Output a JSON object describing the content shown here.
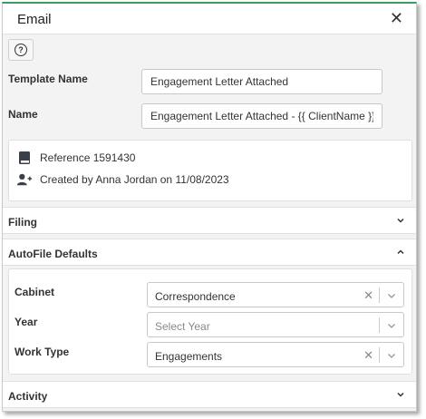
{
  "dialog": {
    "title": "Email",
    "close_glyph": "✕"
  },
  "help": {
    "glyph": "?",
    "icon": "question-circle-icon"
  },
  "form": {
    "template_name_label": "Template Name",
    "template_name_value": "Engagement Letter Attached",
    "name_label": "Name",
    "name_value": "Engagement Letter Attached - {{ ClientName }}"
  },
  "info": {
    "reference": "Reference 1591430",
    "reference_icon": "book-icon",
    "created": "Created by Anna Jordan on 11/08/2023",
    "created_icon": "user-plus-icon"
  },
  "sections": {
    "filing": "Filing",
    "autofile": "AutoFile Defaults",
    "activity": "Activity"
  },
  "autofile": {
    "cabinet_label": "Cabinet",
    "cabinet_value": "Correspondence",
    "year_label": "Year",
    "year_placeholder": "Select Year",
    "work_type_label": "Work Type",
    "work_type_value": "Engagements",
    "clear_glyph": "✕"
  },
  "colors": {
    "accent": "#3a9e5f",
    "panel_bg": "#f3f3f3",
    "border": "#c8c8c8"
  }
}
